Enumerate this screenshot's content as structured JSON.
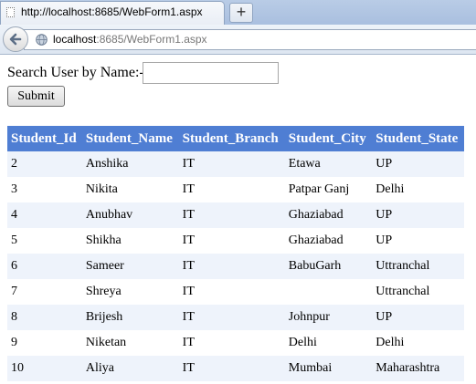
{
  "browser": {
    "tab_title": "http://localhost:8685/WebForm1.aspx",
    "new_tab_label": "+",
    "url_host": "localhost",
    "url_rest": ":8685/WebForm1.aspx",
    "icons": [
      "page-icon",
      "back-arrow-icon",
      "globe-icon"
    ]
  },
  "form": {
    "search_label": "Search User by Name:-",
    "search_value": "",
    "submit_label": "Submit"
  },
  "table": {
    "header_color": "#4f7ed3",
    "alt_row_color": "#eef3fb",
    "columns": [
      "Student_Id",
      "Student_Name",
      "Student_Branch",
      "Student_City",
      "Student_State"
    ],
    "rows": [
      [
        "2",
        "Anshika",
        "IT",
        "Etawa",
        "UP"
      ],
      [
        "3",
        "Nikita",
        "IT",
        "Patpar Ganj",
        "Delhi"
      ],
      [
        "4",
        "Anubhav",
        "IT",
        "Ghaziabad",
        "UP"
      ],
      [
        "5",
        "Shikha",
        "IT",
        "Ghaziabad",
        "UP"
      ],
      [
        "6",
        "Sameer",
        "IT",
        "BabuGarh",
        "Uttranchal"
      ],
      [
        "7",
        "Shreya",
        "IT",
        "",
        "Uttranchal"
      ],
      [
        "8",
        "Brijesh",
        "IT",
        "Johnpur",
        "UP"
      ],
      [
        "9",
        "Niketan",
        "IT",
        "Delhi",
        "Delhi"
      ],
      [
        "10",
        "Aliya",
        "IT",
        "Mumbai",
        "Maharashtra"
      ]
    ]
  }
}
